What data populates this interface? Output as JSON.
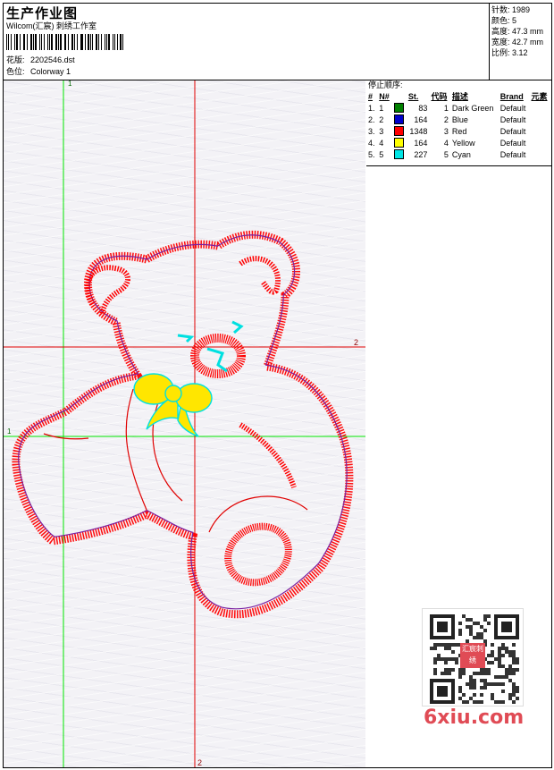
{
  "header": {
    "title": "生产作业图",
    "studio": "Wilcom(汇宸) 刺绣工作室",
    "design_label": "花版:",
    "design_value": "2202546.dst",
    "colorway_label": "色位:",
    "colorway_value": "Colorway 1"
  },
  "stats": [
    {
      "label": "针数:",
      "value": "1989"
    },
    {
      "label": "颜色:",
      "value": "5"
    },
    {
      "label": "高度:",
      "value": "47.3 mm"
    },
    {
      "label": "宽度:",
      "value": "42.7 mm"
    },
    {
      "label": "比例:",
      "value": "3.12"
    }
  ],
  "guides": {
    "label_1_top": "1",
    "label_1_left": "1",
    "label_2_right": "2",
    "label_2_bottom": "2"
  },
  "stop_sequence": {
    "title": "停止顺序:",
    "columns": [
      "#",
      "N#",
      "St.",
      "代码",
      "描述",
      "Brand",
      "元素"
    ],
    "rows": [
      {
        "idx": "1.",
        "n": "1",
        "color": "#008000",
        "st": "83",
        "code": "1",
        "desc": "Dark Green",
        "brand": "Default"
      },
      {
        "idx": "2.",
        "n": "2",
        "color": "#0000cc",
        "st": "164",
        "code": "2",
        "desc": "Blue",
        "brand": "Default"
      },
      {
        "idx": "3.",
        "n": "3",
        "color": "#ff0000",
        "st": "1348",
        "code": "3",
        "desc": "Red",
        "brand": "Default"
      },
      {
        "idx": "4.",
        "n": "4",
        "color": "#ffff00",
        "st": "164",
        "code": "4",
        "desc": "Yellow",
        "brand": "Default"
      },
      {
        "idx": "5.",
        "n": "5",
        "color": "#00e5e5",
        "st": "227",
        "code": "5",
        "desc": "Cyan",
        "brand": "Default"
      }
    ]
  },
  "watermark": {
    "text": "6xiu.com",
    "stamp": "汇宸刺绣"
  },
  "colors": {
    "red": "#ff0000",
    "purple": "#7a1fa0",
    "green": "#00e600",
    "cyan": "#00e0e0",
    "yellow": "#ffe600",
    "watermark": "#e04b55"
  }
}
